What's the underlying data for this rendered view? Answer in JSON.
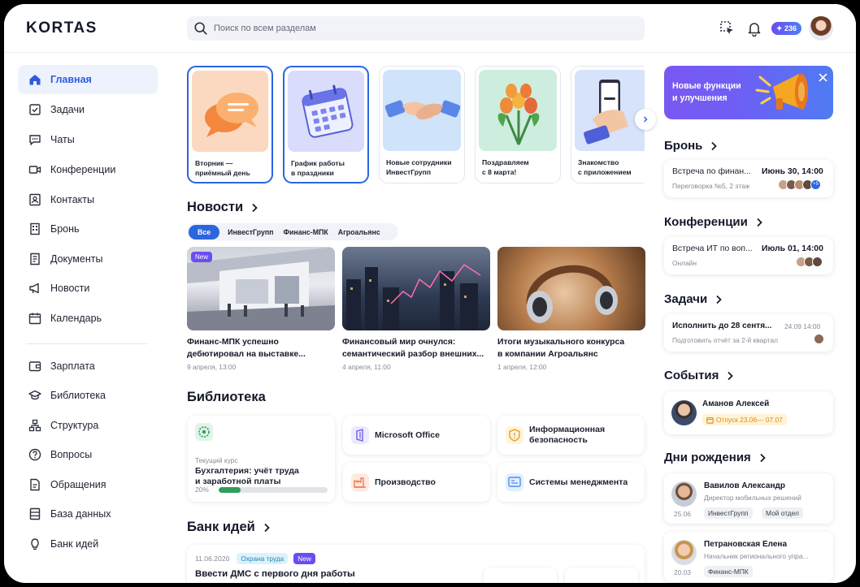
{
  "header": {
    "logo": "KORTAS",
    "search_placeholder": "Поиск по всем разделам",
    "coins": "✦ 236"
  },
  "sidebar": {
    "items": [
      {
        "label": "Главная",
        "icon": "home-icon",
        "active": true
      },
      {
        "label": "Задачи",
        "icon": "task-checkbox-icon"
      },
      {
        "label": "Чаты",
        "icon": "chat-icon"
      },
      {
        "label": "Конференции",
        "icon": "video-camera-icon"
      },
      {
        "label": "Контакты",
        "icon": "contact-card-icon"
      },
      {
        "label": "Бронь",
        "icon": "building-icon"
      },
      {
        "label": "Документы",
        "icon": "document-icon"
      },
      {
        "label": "Новости",
        "icon": "megaphone-icon"
      },
      {
        "label": "Календарь",
        "icon": "calendar-icon"
      },
      {
        "label": "Зарплата",
        "icon": "wallet-icon"
      },
      {
        "label": "Библиотека",
        "icon": "graduation-cap-icon"
      },
      {
        "label": "Структура",
        "icon": "org-structure-icon"
      },
      {
        "label": "Вопросы",
        "icon": "question-icon"
      },
      {
        "label": "Обращения",
        "icon": "request-doc-icon"
      },
      {
        "label": "База данных",
        "icon": "database-icon"
      },
      {
        "label": "Банк идей",
        "icon": "lightbulb-icon"
      }
    ]
  },
  "stories": [
    {
      "caption_1": "Вторник —",
      "caption_2": "приёмный день",
      "bg": "#fbd9c0"
    },
    {
      "caption_1": "График работы",
      "caption_2": "в праздники",
      "bg": "#d9dcfb"
    },
    {
      "caption_1": "Новые сотрудники",
      "caption_2": "ИнвестГрупп",
      "bg": "#cfe3fb"
    },
    {
      "caption_1": "Поздравляем",
      "caption_2": "с 8 марта!",
      "bg": "#cdeede"
    },
    {
      "caption_1": "Знакомство",
      "caption_2": "с приложением",
      "bg": "#d7e2fb"
    }
  ],
  "news": {
    "title": "Новости",
    "chips": [
      "Все",
      "ИнвестГрупп",
      "Финанс-МПК",
      "Агроальянс"
    ],
    "badge": "New",
    "items": [
      {
        "title_1": "Финанс-МПК успешно",
        "title_2": "дебютировал на выставке...",
        "date": "9 апреля, 13:00"
      },
      {
        "title_1": "Финансовый мир очнулся:",
        "title_2": "семантический разбор внешних...",
        "date": "4 апреля, 11:00"
      },
      {
        "title_1": "Итоги музыкального конкурса",
        "title_2": "в компании Агроальянс",
        "date": "1 апреля, 12:00"
      }
    ]
  },
  "library": {
    "title": "Библиотека",
    "course": {
      "label": "Текущий курс",
      "title_1": "Бухгалтерия: учёт труда",
      "title_2": "и заработной платы",
      "progress_label": "20%",
      "progress": 0.2
    },
    "items": [
      {
        "label": "Microsoft Office"
      },
      {
        "label_1": "Информационная",
        "label_2": "безопасность"
      },
      {
        "label": "Производство"
      },
      {
        "label": "Системы менеджмента"
      }
    ]
  },
  "ideas": {
    "title": "Банк идей",
    "date": "11.06.2020",
    "tag1": "Охрана труда",
    "tag2": "New",
    "idea_title": "Ввести ДМС с первого дня работы"
  },
  "right": {
    "promo": {
      "line1": "Новые функции",
      "line2": "и улучшения"
    },
    "booking": {
      "title": "Бронь",
      "name": "Встреча по финан...",
      "date": "Июнь 30, 14:00",
      "place": "Переговорка №5, 2 этаж",
      "more": "+5"
    },
    "conf": {
      "title": "Конференции",
      "name": "Встреча ИТ по воп...",
      "date": "Июль 01, 14:00",
      "mode": "Онлайн"
    },
    "tasks": {
      "title": "Задачи",
      "name": "Исполнить до 28 сентя...",
      "date": "24.09 14:00",
      "desc": "Подготовить отчёт за 2-й квартал"
    },
    "events": {
      "title": "События",
      "person": "Аманов Алексей",
      "status": "Отпуск 23.06— 07.07"
    },
    "birthdays": {
      "title": "Дни рождения",
      "people": [
        {
          "name": "Вавилов Александр",
          "role": "Директор мобильных решений",
          "date": "25.06",
          "tags": [
            "ИнвестГрупп",
            "Мой отдел"
          ]
        },
        {
          "name": "Петрановская Елена",
          "role": "Начальник регионального упра...",
          "date": "20.03",
          "tags": [
            "Финанс-МПК"
          ]
        }
      ]
    }
  }
}
